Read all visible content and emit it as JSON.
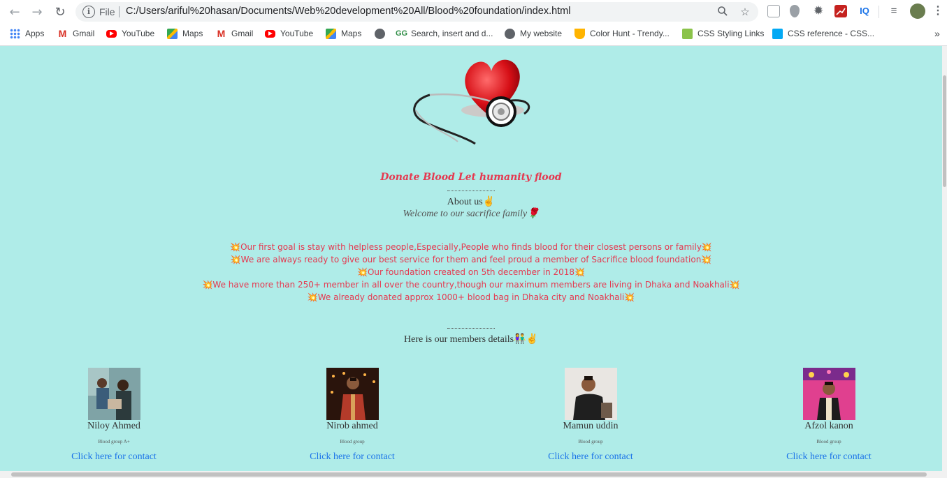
{
  "browser": {
    "file_label": "File",
    "url": "C:/Users/ariful%20hasan/Documents/Web%20development%20All/Blood%20foundation/index.html",
    "extensions": [
      "IQ"
    ],
    "bookmarks": [
      {
        "label": "Apps",
        "icon": "apps-grid-icon",
        "color": "#4285f4"
      },
      {
        "label": "Gmail",
        "icon": "gmail-icon",
        "color": "#d93025"
      },
      {
        "label": "YouTube",
        "icon": "youtube-icon",
        "color": "#ff0000"
      },
      {
        "label": "Maps",
        "icon": "maps-icon",
        "color": "#34a853"
      },
      {
        "label": "Gmail",
        "icon": "gmail-icon",
        "color": "#d93025"
      },
      {
        "label": "YouTube",
        "icon": "youtube-icon",
        "color": "#ff0000"
      },
      {
        "label": "Maps",
        "icon": "maps-icon",
        "color": "#34a853"
      },
      {
        "label": "",
        "icon": "globe-icon",
        "color": "#5f6368"
      },
      {
        "label": "Search, insert and d...",
        "icon": "geeksforgeeks-icon",
        "color": "#2f8d46"
      },
      {
        "label": "My website",
        "icon": "globe-icon",
        "color": "#5f6368"
      },
      {
        "label": "Color Hunt - Trendy...",
        "icon": "color-hunt-icon",
        "color": "#ffb400"
      },
      {
        "label": "CSS Styling Links",
        "icon": "css-links-icon",
        "color": "#8bc34a"
      },
      {
        "label": "CSS reference - CSS...",
        "icon": "css-reference-icon",
        "color": "#03a9f4"
      }
    ],
    "more_bookmarks": "»"
  },
  "page": {
    "tagline": "Donate Blood Let humanity flood",
    "about": "About us✌",
    "welcome": "Welcome to our sacrifice family🌹",
    "goals": [
      "💥Our first goal is stay with helpless people,Especially,People who finds blood for their closest persons or family💥",
      "💥We are always ready to give our best service for them and feel proud a member of Sacrifice blood foundation💥",
      "💥Our foundation created on 5th december in 2018💥",
      "💥We have more than 250+ member in all over the country,though our maximum members are living in Dhaka and Noakhali💥",
      "💥We already donated approx 1000+ blood bag in Dhaka city and Noakhali💥"
    ],
    "members_title": "Here is our members details👫✌",
    "members": [
      {
        "name": "Niloy Ahmed",
        "blood": "Blood group A+",
        "contact": "Click here for contact"
      },
      {
        "name": "Nirob ahmed",
        "blood": "Blood group",
        "contact": "Click here for contact"
      },
      {
        "name": "Mamun uddin",
        "blood": "Blood group",
        "contact": "Click here for contact"
      },
      {
        "name": "Afzol kanon",
        "blood": "Blood group",
        "contact": "Click here for contact"
      }
    ]
  },
  "colors": {
    "background": "#afece8",
    "accent": "#e53950",
    "link": "#1a73e8"
  }
}
